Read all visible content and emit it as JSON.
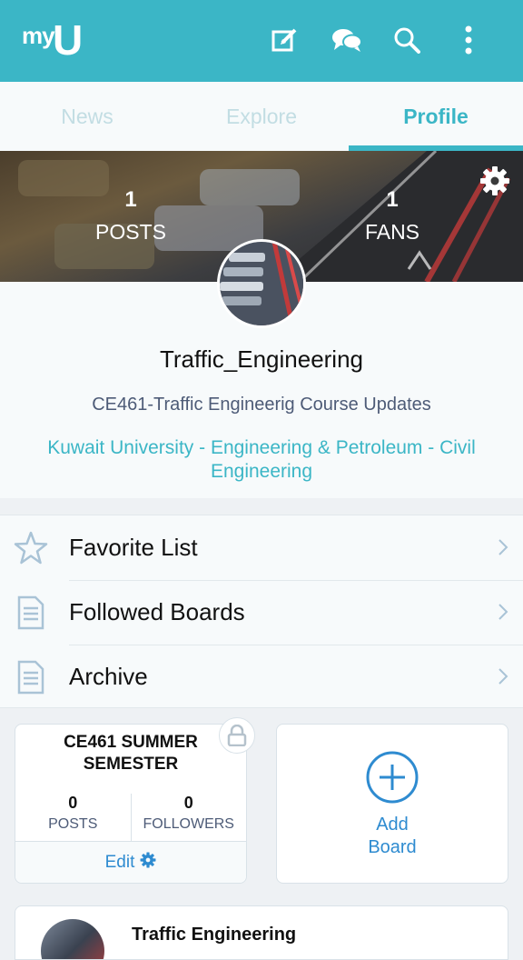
{
  "app": {
    "logo_my": "my",
    "logo_u": "U"
  },
  "appbar": {
    "icons": [
      "edit-icon",
      "chat-icon",
      "search-icon",
      "more-vert-icon"
    ]
  },
  "tabs": [
    {
      "label": "News",
      "active": false
    },
    {
      "label": "Explore",
      "active": false
    },
    {
      "label": "Profile",
      "active": true
    }
  ],
  "cover": {
    "posts": {
      "count": "1",
      "label": "POSTS"
    },
    "fans": {
      "count": "1",
      "label": "FANS"
    }
  },
  "profile": {
    "username": "Traffic_Engineering",
    "description": "CE461-Traffic Engineerig Course Updates",
    "organization": "Kuwait University - Engineering & Petroleum - Civil Engineering"
  },
  "menu": {
    "items": [
      {
        "label": "Favorite List",
        "icon": "star-icon"
      },
      {
        "label": "Followed Boards",
        "icon": "document-icon"
      },
      {
        "label": "Archive",
        "icon": "document-icon"
      }
    ]
  },
  "boards": [
    {
      "title": "CE461 SUMMER SEMESTER",
      "posts_count": "0",
      "posts_label": "POSTS",
      "followers_count": "0",
      "followers_label": "FOLLOWERS",
      "edit_label": "Edit"
    }
  ],
  "add_board": {
    "label_line1": "Add",
    "label_line2": "Board"
  },
  "post_preview": {
    "title": "Traffic Engineering"
  },
  "colors": {
    "accent": "#3bb6c6",
    "link_blue": "#2e8bd0",
    "muted_tab": "#c2dde3"
  }
}
